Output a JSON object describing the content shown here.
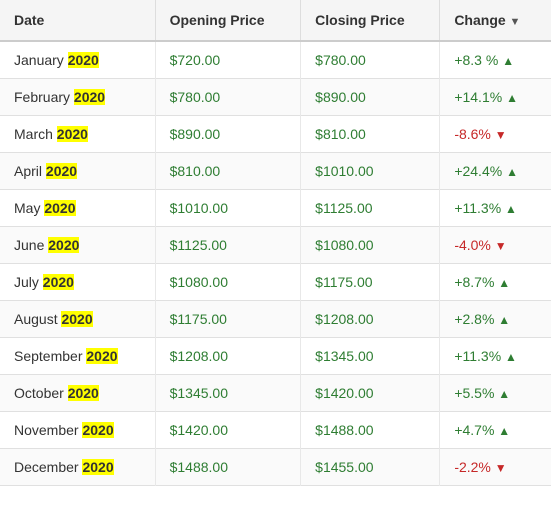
{
  "table": {
    "headers": {
      "date": "Date",
      "opening_price": "Opening Price",
      "closing_price": "Closing Price",
      "change": "Change"
    },
    "rows": [
      {
        "month": "January",
        "year": "2020",
        "opening": "$720.00",
        "closing": "$780.00",
        "change": "+8.3 %",
        "direction": "up"
      },
      {
        "month": "February",
        "year": "2020",
        "opening": "$780.00",
        "closing": "$890.00",
        "change": "+14.1%",
        "direction": "up"
      },
      {
        "month": "March",
        "year": "2020",
        "opening": "$890.00",
        "closing": "$810.00",
        "change": "-8.6%",
        "direction": "down"
      },
      {
        "month": "April",
        "year": "2020",
        "opening": "$810.00",
        "closing": "$1010.00",
        "change": "+24.4%",
        "direction": "up"
      },
      {
        "month": "May",
        "year": "2020",
        "opening": "$1010.00",
        "closing": "$1125.00",
        "change": "+11.3%",
        "direction": "up"
      },
      {
        "month": "June",
        "year": "2020",
        "opening": "$1125.00",
        "closing": "$1080.00",
        "change": "-4.0%",
        "direction": "down"
      },
      {
        "month": "July",
        "year": "2020",
        "opening": "$1080.00",
        "closing": "$1175.00",
        "change": "+8.7%",
        "direction": "up"
      },
      {
        "month": "August",
        "year": "2020",
        "opening": "$1175.00",
        "closing": "$1208.00",
        "change": "+2.8%",
        "direction": "up"
      },
      {
        "month": "September",
        "year": "2020",
        "opening": "$1208.00",
        "closing": "$1345.00",
        "change": "+11.3%",
        "direction": "up"
      },
      {
        "month": "October",
        "year": "2020",
        "opening": "$1345.00",
        "closing": "$1420.00",
        "change": "+5.5%",
        "direction": "up"
      },
      {
        "month": "November",
        "year": "2020",
        "opening": "$1420.00",
        "closing": "$1488.00",
        "change": "+4.7%",
        "direction": "up"
      },
      {
        "month": "December",
        "year": "2020",
        "opening": "$1488.00",
        "closing": "$1455.00",
        "change": "-2.2%",
        "direction": "down"
      }
    ]
  }
}
